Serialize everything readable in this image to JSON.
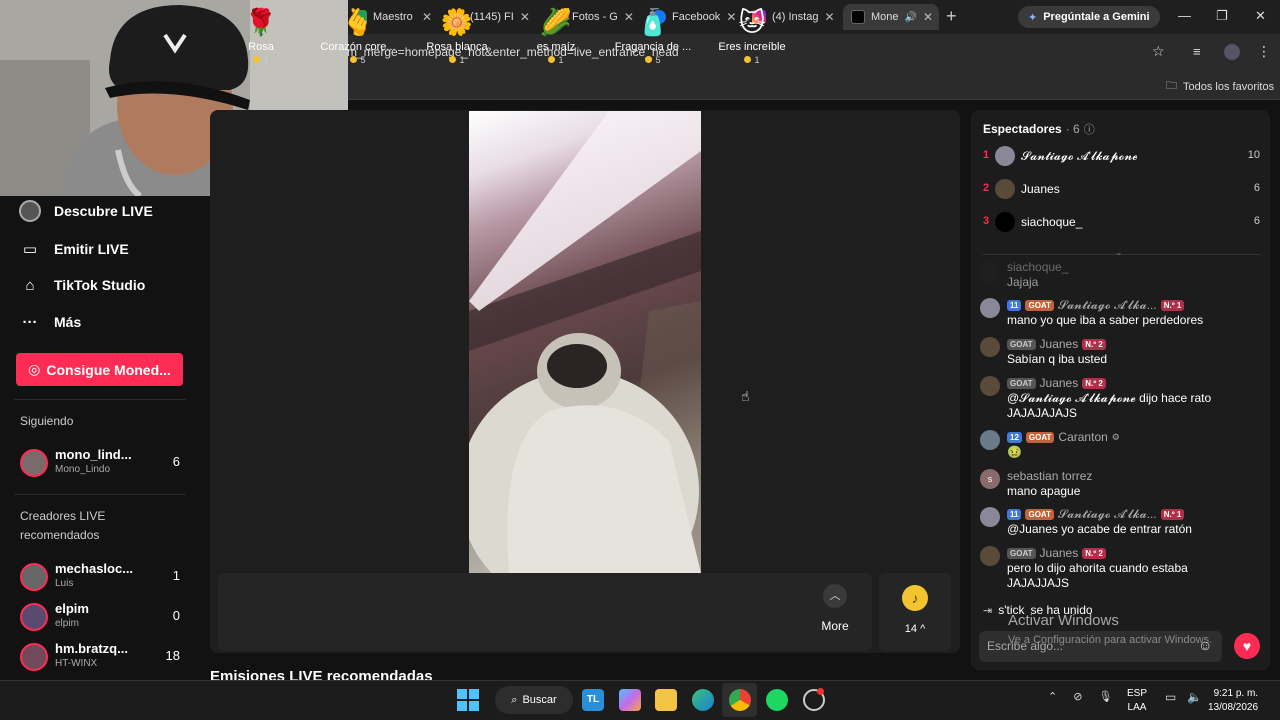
{
  "browser": {
    "tabs": [
      {
        "label": "Maestro"
      },
      {
        "label": "(1145) FI"
      },
      {
        "label": "Fotos - G"
      },
      {
        "label": "Facebook"
      },
      {
        "label": "(4) Instag"
      },
      {
        "label": "Mone"
      }
    ],
    "gemini_label": "Pregúntale a Gemini",
    "url": "m_merge=homepage_hot&enter_method=live_entrance_head",
    "favorites_label": "Todos los favoritos"
  },
  "sidebar": {
    "items": [
      {
        "label": "Descubre LIVE",
        "icon": "live-avatar-icon"
      },
      {
        "label": "Emitir LIVE",
        "icon": "camera-icon"
      },
      {
        "label": "TikTok Studio",
        "icon": "studio-icon"
      },
      {
        "label": "Más",
        "icon": "more-dots-icon"
      }
    ],
    "coins_button": "Consigue Moned...",
    "following_label": "Siguiendo",
    "following": [
      {
        "name": "mono_lind...",
        "sub": "Mono_Lindo",
        "count": "6"
      }
    ],
    "recommended_label_1": "Creadores LIVE",
    "recommended_label_2": "recomendados",
    "recommended": [
      {
        "name": "mechasloc...",
        "sub": "Luis",
        "count": "1"
      },
      {
        "name": "elpim",
        "sub": "elpim",
        "count": "0"
      },
      {
        "name": "hm.bratzq...",
        "sub": "HT-WINX",
        "count": "18"
      }
    ]
  },
  "gifts": [
    {
      "name": "Rosa",
      "price": "1",
      "icon": "rose-icon",
      "glyph": "🌹"
    },
    {
      "name": "Corazón core...",
      "price": "5",
      "icon": "finger-heart-icon",
      "glyph": "🫰"
    },
    {
      "name": "Rosa blanca",
      "price": "1",
      "icon": "white-rose-icon",
      "glyph": "🌼"
    },
    {
      "name": "es maíz",
      "price": "1",
      "icon": "corn-icon",
      "glyph": "🌽"
    },
    {
      "name": "Fragancia de ...",
      "price": "5",
      "icon": "perfume-icon",
      "glyph": "🧴"
    },
    {
      "name": "Eres increíble",
      "price": "1",
      "icon": "cat-icon",
      "glyph": "🐱"
    }
  ],
  "more_label": "More",
  "coin_count": "14",
  "emissions_heading": "Emisiones LIVE recomendadas",
  "viewers": {
    "title": "Espectadores",
    "count": "· 6",
    "list": [
      {
        "rank": "1",
        "name": "𝓢𝓪𝓷𝓽𝓲𝓪𝓰𝓸 𝓐'𝓵𝓴𝓪𝓹𝓸𝓷𝓮",
        "score": "10"
      },
      {
        "rank": "2",
        "name": "Juanes",
        "score": "6"
      },
      {
        "rank": "3",
        "name": "siachoque_",
        "score": "6"
      }
    ]
  },
  "chat": [
    {
      "user": "siachoque_",
      "badges": [],
      "text": "Jajaja"
    },
    {
      "user": "𝓢𝓪𝓷𝓽𝓲𝓪𝓰𝓸 𝓐'𝓵𝓴𝓪...",
      "badges": [
        "11",
        "GOAT",
        "N.º 1"
      ],
      "text": "mano yo que iba a saber perdedores"
    },
    {
      "user": "Juanes",
      "badges": [
        "GOAT",
        "N.º 2"
      ],
      "text": "Sabían q iba usted"
    },
    {
      "user": "Juanes",
      "badges": [
        "GOAT",
        "N.º 2"
      ],
      "text": "@𝓢𝓪𝓷𝓽𝓲𝓪𝓰𝓸 𝓐'𝓵𝓴𝓪𝓹𝓸𝓷𝓮 dijo hace rato JAJAJAJAJS"
    },
    {
      "user": "Caranton",
      "badges": [
        "12",
        "GOAT"
      ],
      "text": "🤢"
    },
    {
      "user": "sebastian torrez",
      "badges": [],
      "text": "mano apague"
    },
    {
      "user": "𝓢𝓪𝓷𝓽𝓲𝓪𝓰𝓸 𝓐'𝓵𝓴𝓪...",
      "badges": [
        "11",
        "GOAT",
        "N.º 1"
      ],
      "text": "@Juanes yo acabe de entrar ratón"
    },
    {
      "user": "Juanes",
      "badges": [
        "GOAT",
        "N.º 2"
      ],
      "text": "pero lo dijo ahorita cuando estaba JAJAJJAJS"
    }
  ],
  "joined": {
    "user": "s'tick",
    "text": "se ha unido"
  },
  "chat_input_placeholder": "Escribe algo...",
  "windows_activation": {
    "title": "Activar Windows",
    "sub": "Ve a Configuración para activar Windows."
  },
  "taskbar": {
    "search_label": "Buscar",
    "lang_1": "ESP",
    "lang_2": "LAA",
    "time": "9:21 p. m.",
    "date": "13/08/2026"
  }
}
